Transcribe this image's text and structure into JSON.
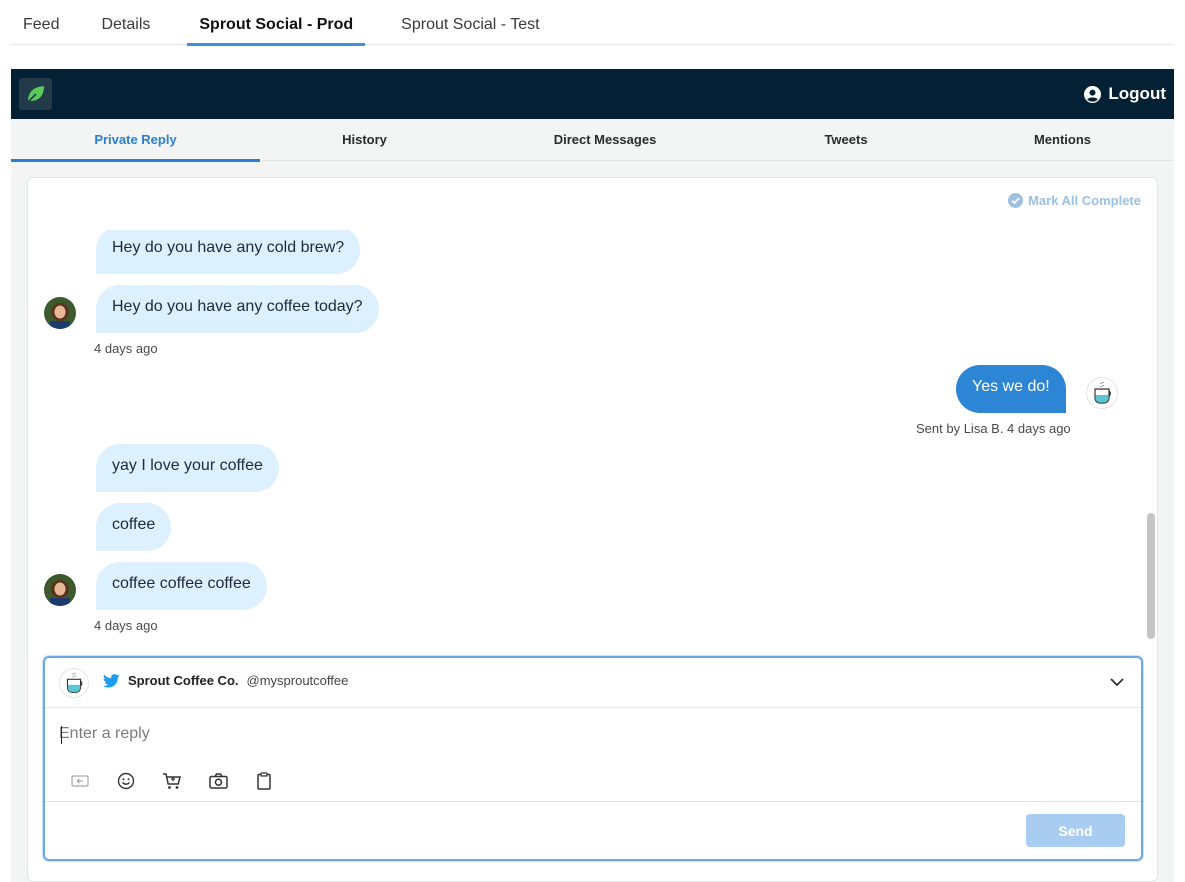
{
  "top_tabs": [
    {
      "label": "Feed",
      "active": false
    },
    {
      "label": "Details",
      "active": false
    },
    {
      "label": "Sprout Social - Prod",
      "active": true
    },
    {
      "label": "Sprout Social - Test",
      "active": false
    }
  ],
  "header": {
    "logo_icon": "sprout-leaf-icon",
    "logout_label": "Logout",
    "logout_icon": "user-circle-icon",
    "brand_color": "#042035",
    "leaf_color": "#59cb59"
  },
  "subnav": [
    {
      "label": "Private Reply",
      "active": true
    },
    {
      "label": "History",
      "active": false
    },
    {
      "label": "Direct Messages",
      "active": false
    },
    {
      "label": "Tweets",
      "active": false
    },
    {
      "label": "Mentions",
      "active": false
    }
  ],
  "panel": {
    "mark_all_label": "Mark All Complete",
    "mark_all_icon": "check-circle-icon"
  },
  "messages": {
    "group1": {
      "bubbles": [
        "Hey do you have any cold brew?",
        "Hey do you have any coffee today?"
      ],
      "time": "4 days ago"
    },
    "outgoing": {
      "text": "Yes we do!",
      "meta": "Sent by Lisa B. 4 days ago"
    },
    "group2": {
      "bubbles": [
        "yay I love your coffee",
        "coffee",
        "coffee coffee coffee"
      ],
      "time": "4 days ago"
    }
  },
  "composer": {
    "account_name": "Sprout Coffee Co.",
    "account_handle": "@mysproutcoffee",
    "network_icon": "twitter-icon",
    "reply_placeholder": "Enter a reply",
    "reply_value": "",
    "tools": [
      "reply-template-icon",
      "emoji-icon",
      "cart-icon",
      "camera-icon",
      "clipboard-icon"
    ],
    "send_label": "Send",
    "accent_color": "#2d85d6"
  }
}
